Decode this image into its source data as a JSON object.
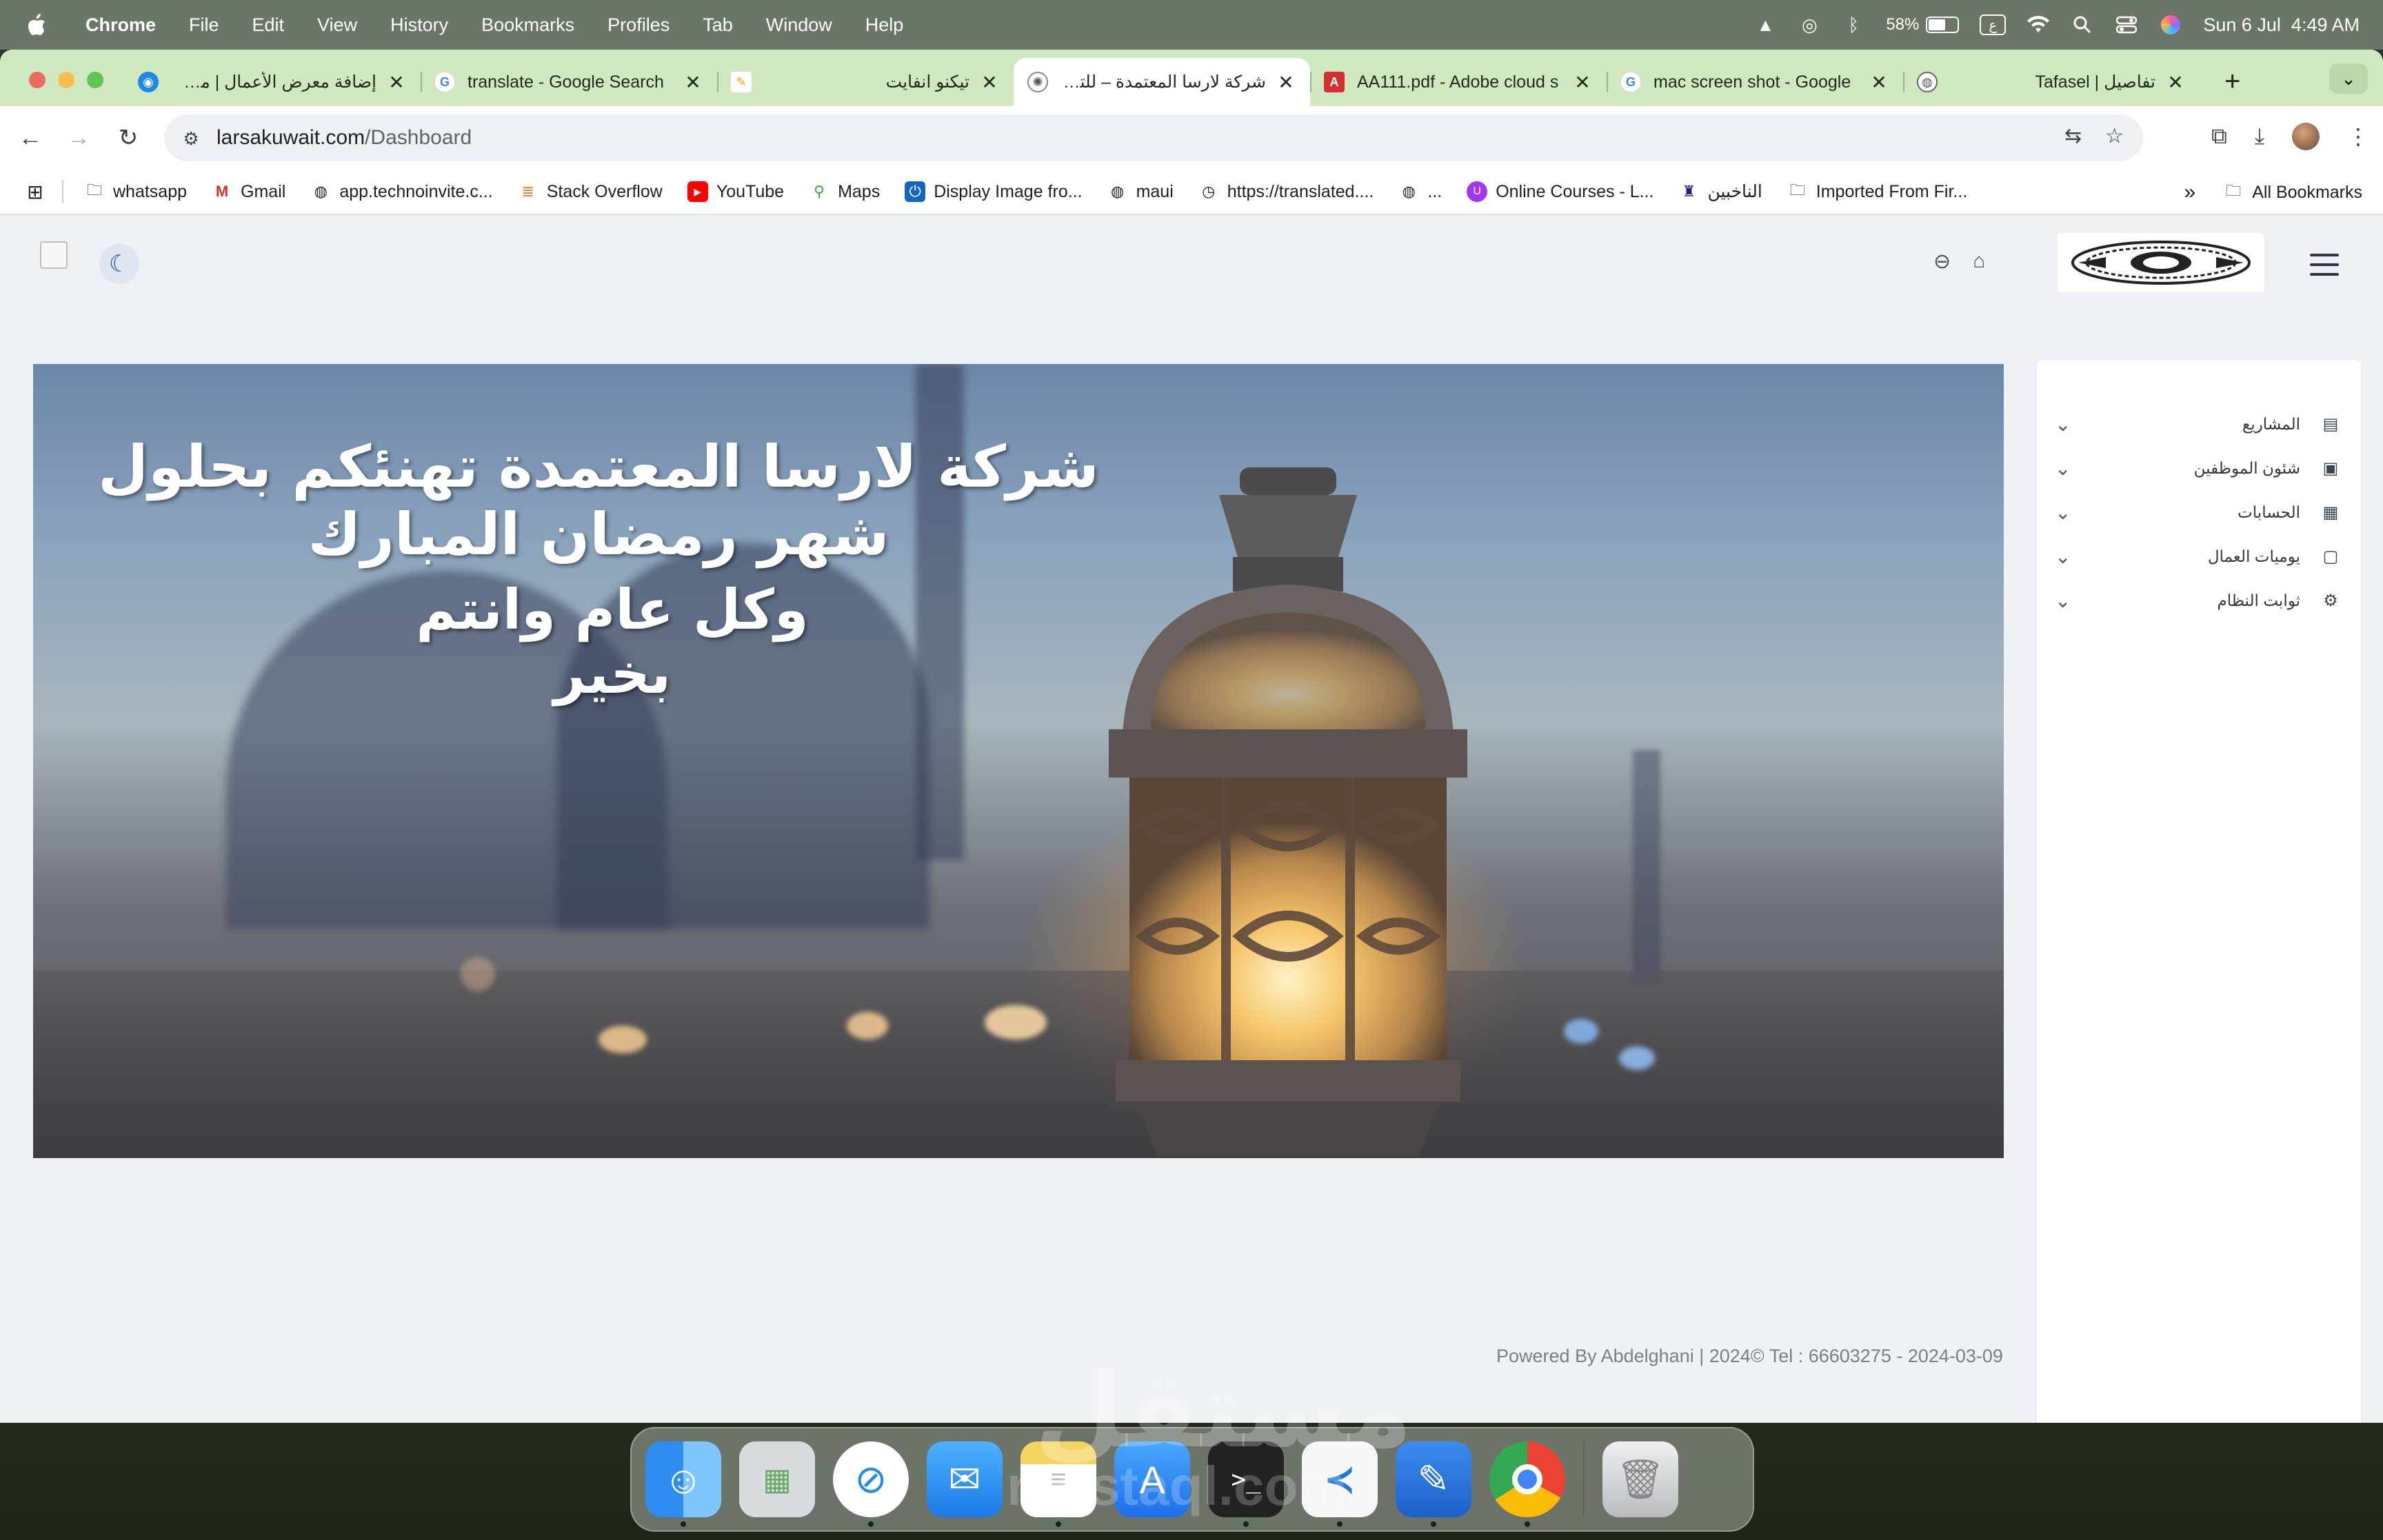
{
  "menubar": {
    "app": "Chrome",
    "items": [
      "File",
      "Edit",
      "View",
      "History",
      "Bookmarks",
      "Profiles",
      "Tab",
      "Window",
      "Help"
    ],
    "battery": "58%",
    "battery_level": 0.58,
    "datetime": "Sun 6 Jul  4:49 AM",
    "input_source": "ع"
  },
  "tabs": [
    {
      "title": "إضافة معرض الأعمال | مستقل",
      "rtl": true,
      "favicon_color": "#1e88e5"
    },
    {
      "title": "translate - Google Search",
      "rtl": false,
      "favicon_color": "#4285f4"
    },
    {
      "title": "تيكنو انفايت",
      "rtl": true,
      "favicon_color": "#f5b400"
    },
    {
      "title": "شركة لارسا المعتمدة – للتجارة",
      "rtl": true,
      "favicon_color": "#555555"
    },
    {
      "title": "AA111.pdf - Adobe cloud s",
      "rtl": false,
      "favicon_color": "#d32f2f"
    },
    {
      "title": "mac screen shot - Google",
      "rtl": false,
      "favicon_color": "#4285f4"
    },
    {
      "title": "Tafasel | تفاصيل",
      "rtl": false,
      "favicon_color": "#555555"
    }
  ],
  "address": {
    "domain": "larsakuwait.com",
    "path": "/Dashboard"
  },
  "bookmarks": [
    {
      "label": "whatsapp",
      "icon": "folder-icon"
    },
    {
      "label": "Gmail",
      "icon": "gmail-icon"
    },
    {
      "label": "app.technoinvite.c...",
      "icon": "globe-icon"
    },
    {
      "label": "Stack Overflow",
      "icon": "stackoverflow-icon"
    },
    {
      "label": "YouTube",
      "icon": "youtube-icon"
    },
    {
      "label": "Maps",
      "icon": "maps-icon"
    },
    {
      "label": "Display Image fro...",
      "icon": "power-icon"
    },
    {
      "label": "maui",
      "icon": "globe-icon"
    },
    {
      "label": "https://translated....",
      "icon": "clock-icon"
    },
    {
      "label": "...",
      "icon": "globe-icon"
    },
    {
      "label": "Online Courses - L...",
      "icon": "udemy-icon"
    },
    {
      "label": "الناخبين",
      "icon": "emblem-icon"
    },
    {
      "label": "Imported From Fir...",
      "icon": "folder-icon"
    }
  ],
  "all_bookmarks": "All Bookmarks",
  "hero": {
    "line1": "شركة لارسا المعتمدة تهنئكم بحلول شهر رمضان المبارك",
    "line2": "وكل عام وانتم بخير"
  },
  "sidebar": {
    "items": [
      {
        "label": "المشاريع",
        "icon": "list-icon"
      },
      {
        "label": "شئون الموظفين",
        "icon": "id-card-icon"
      },
      {
        "label": "الحسابات",
        "icon": "clipboard-icon"
      },
      {
        "label": "يوميات العمال",
        "icon": "calendar-icon"
      },
      {
        "label": "ثوابت النظام",
        "icon": "gear-icon"
      }
    ]
  },
  "footer": "Powered By Abdelghani | 2024© Tel : 66603275 - 2024-03-09",
  "dock": [
    {
      "name": "finder",
      "color": "#2f8cf0"
    },
    {
      "name": "launchpad",
      "color": "#d7dbe0"
    },
    {
      "name": "safari",
      "color": "#1f8af0"
    },
    {
      "name": "mail",
      "color": "#3d9bf2"
    },
    {
      "name": "notes",
      "color": "#f6d462"
    },
    {
      "name": "app-store",
      "color": "#2d8ef2"
    },
    {
      "name": "terminal",
      "color": "#222222"
    },
    {
      "name": "vscode",
      "color": "#f4f6f8"
    },
    {
      "name": "instruments",
      "color": "#2978e8"
    },
    {
      "name": "chrome",
      "color": "#ffffff"
    },
    {
      "name": "trash",
      "color": "#c9ccd0"
    }
  ],
  "watermark": {
    "arabic": "مستقل",
    "latin": "mostaql.com"
  }
}
